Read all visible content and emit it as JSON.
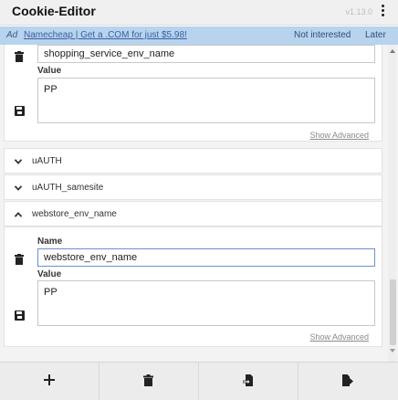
{
  "header": {
    "title": "Cookie-Editor",
    "version": "v1.13.0"
  },
  "ad": {
    "label": "Ad",
    "link_text": "Namecheap | Get a .COM for just $5.98!",
    "not_interested": "Not interested",
    "later": "Later"
  },
  "cookies": {
    "first": {
      "name_value": "shopping_service_env_name",
      "value_label": "Value",
      "value": "PP",
      "show_advanced": "Show Advanced"
    },
    "collapsed": [
      {
        "name": "uAUTH"
      },
      {
        "name": "uAUTH_samesite"
      }
    ],
    "expanded": {
      "name": "webstore_env_name",
      "name_label": "Name",
      "name_value": "webstore_env_name",
      "value_label": "Value",
      "value": "PP",
      "show_advanced": "Show Advanced"
    }
  },
  "toolbar": {
    "buttons": [
      {
        "icon": "plus-icon"
      },
      {
        "icon": "trash-icon"
      },
      {
        "icon": "import-icon"
      },
      {
        "icon": "export-icon"
      }
    ]
  },
  "colors": {
    "ad_background": "#b7d3ee",
    "focus_border": "#6d8fd0"
  }
}
